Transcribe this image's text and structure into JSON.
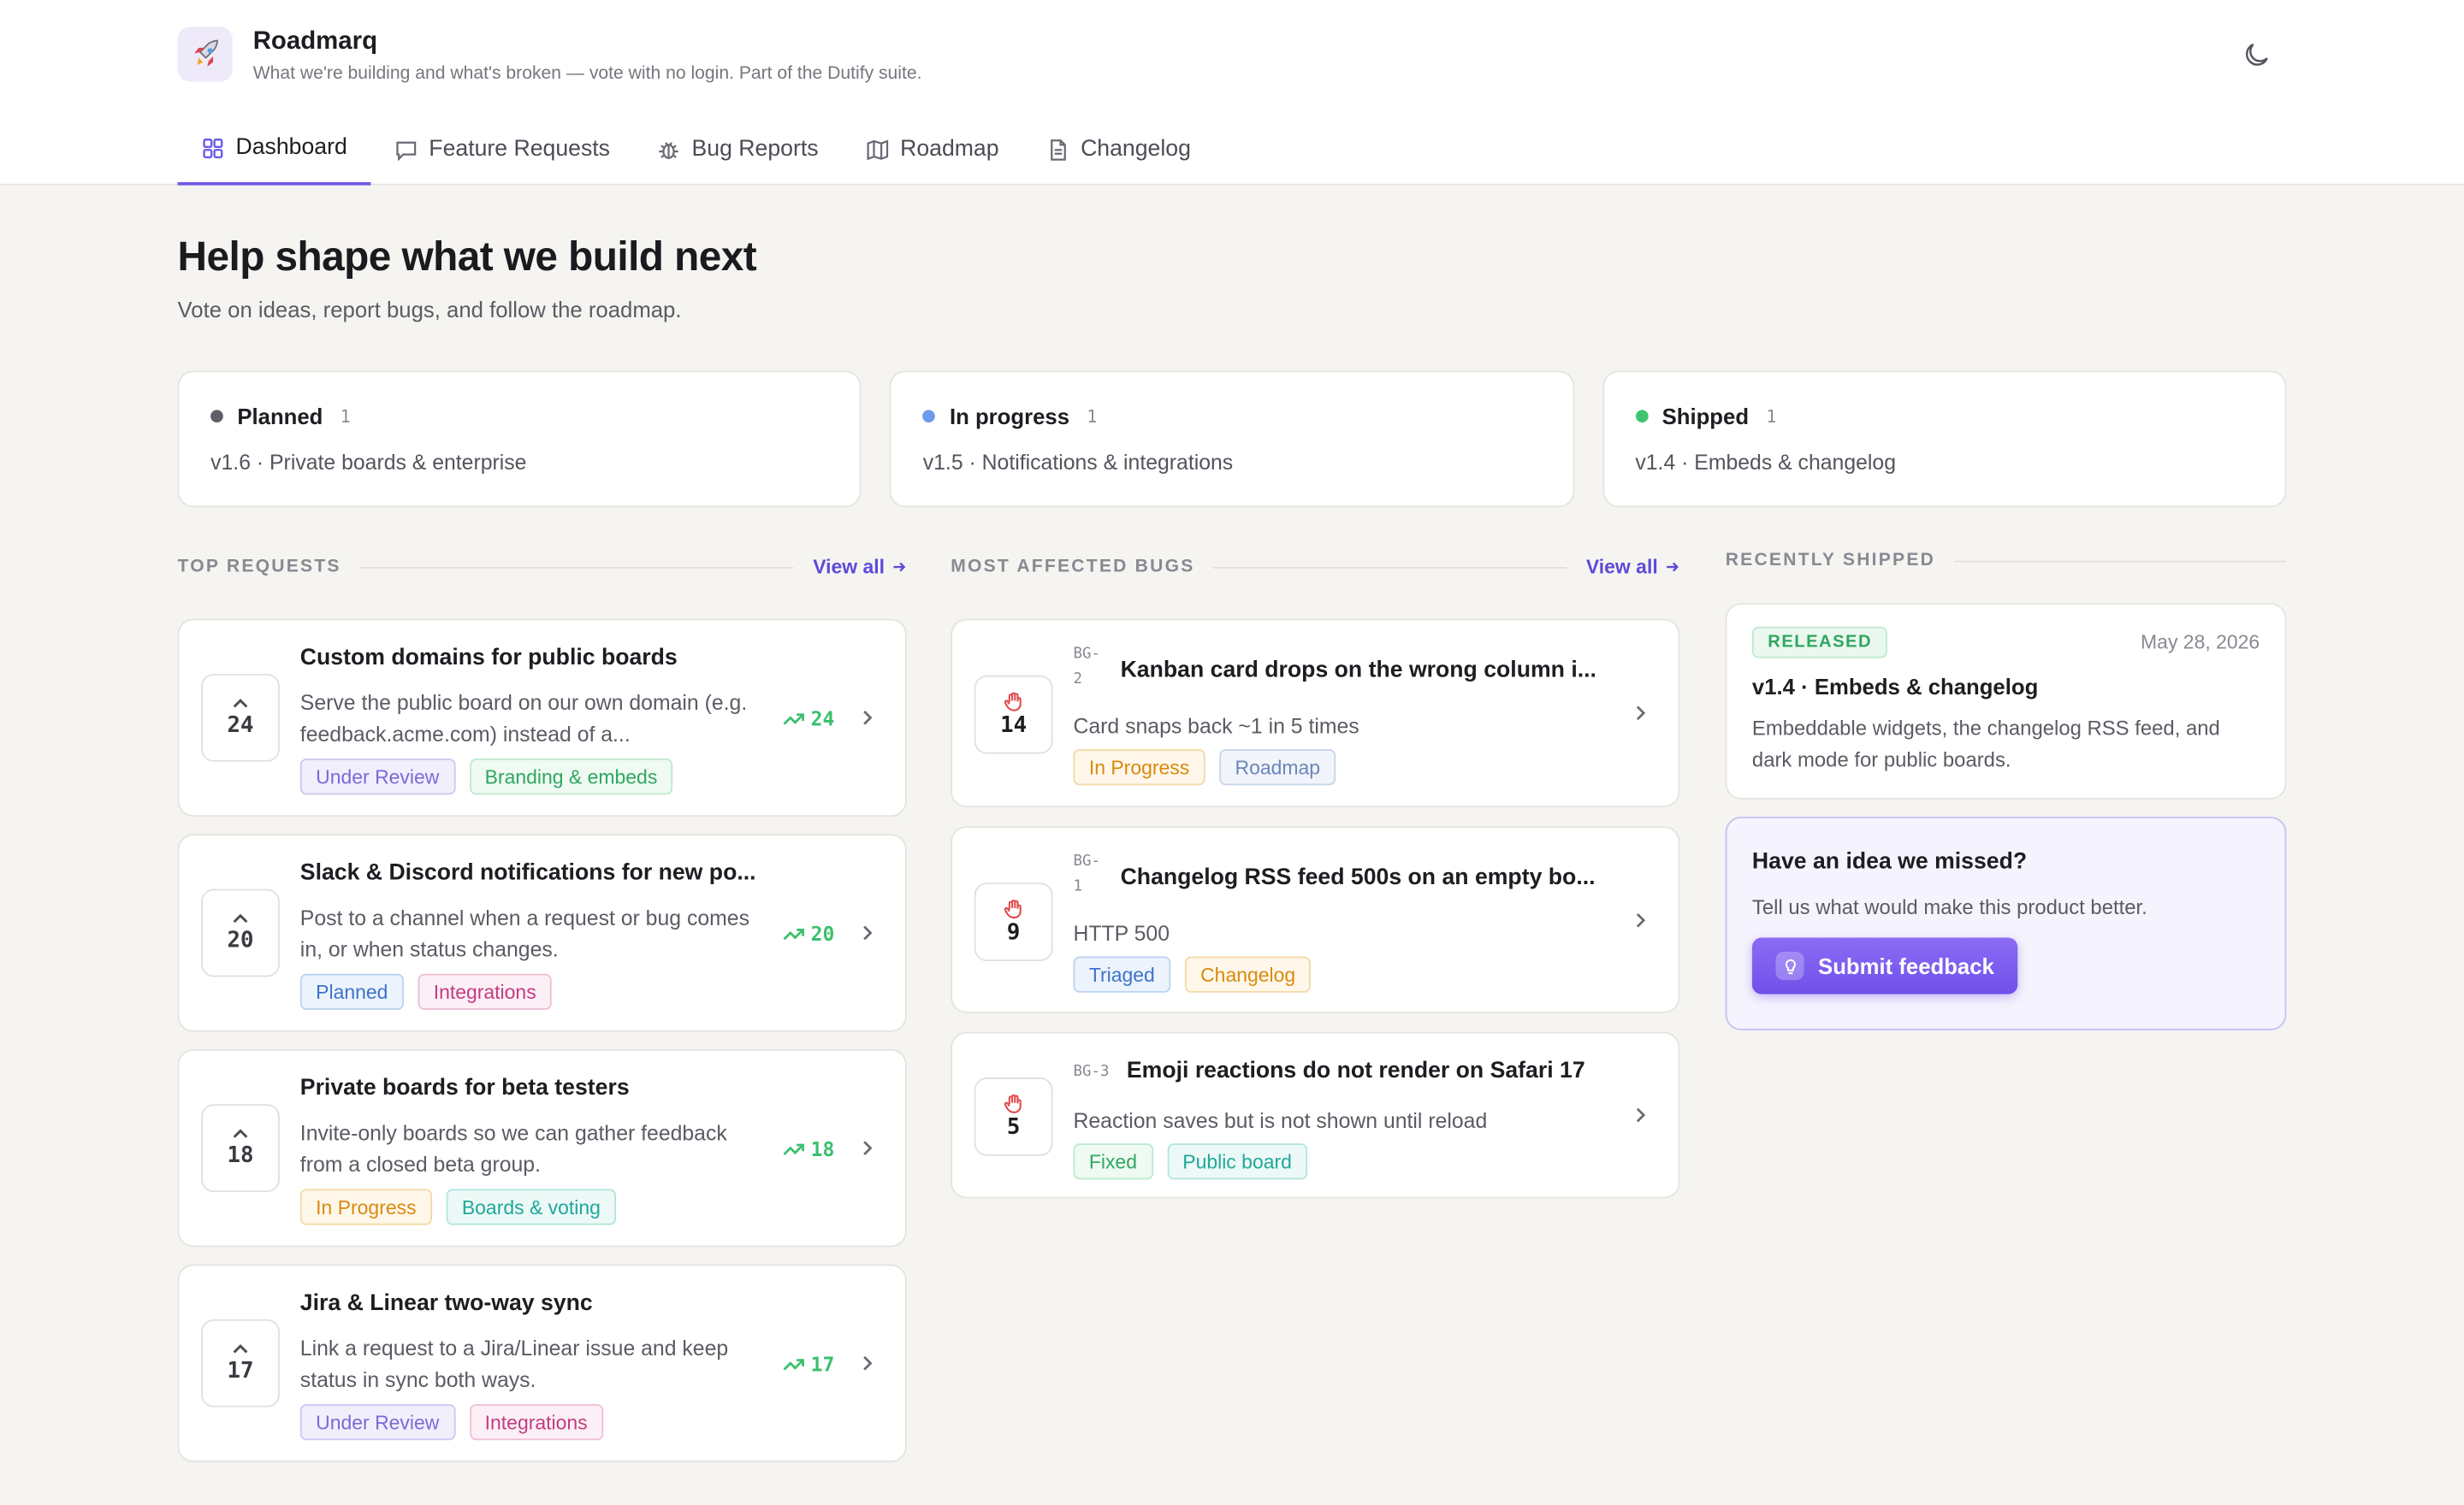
{
  "app": {
    "name": "Roadmarq",
    "tagline": "What we're building and what's broken — vote with no login. Part of the Dutify suite."
  },
  "tabs": [
    {
      "label": "Dashboard",
      "active": true
    },
    {
      "label": "Feature Requests"
    },
    {
      "label": "Bug Reports"
    },
    {
      "label": "Roadmap"
    },
    {
      "label": "Changelog"
    }
  ],
  "hero": {
    "title": "Help shape what we build next",
    "subtitle": "Vote on ideas, report bugs, and follow the roadmap."
  },
  "status_cards": [
    {
      "label": "Planned",
      "count": "1",
      "release": "v1.6 · Private boards & enterprise",
      "color": "#5f5e66"
    },
    {
      "label": "In progress",
      "count": "1",
      "release": "v1.5 · Notifications & integrations",
      "color": "#6b9bea"
    },
    {
      "label": "Shipped",
      "count": "1",
      "release": "v1.4 · Embeds & changelog",
      "color": "#3fc46f"
    }
  ],
  "requests": {
    "heading": "TOP REQUESTS",
    "view_all": "View all",
    "items": [
      {
        "votes": "24",
        "title": "Custom domains for public boards",
        "desc": "Serve the public board on our own domain (e.g. feedback.acme.com) instead of a...",
        "trend": "24",
        "tags": [
          "Under Review",
          "Branding & embeds"
        ]
      },
      {
        "votes": "20",
        "title": "Slack & Discord notifications for new po...",
        "desc": "Post to a channel when a request or bug comes in, or when status changes.",
        "trend": "20",
        "tags": [
          "Planned",
          "Integrations"
        ]
      },
      {
        "votes": "18",
        "title": "Private boards for beta testers",
        "desc": "Invite-only boards so we can gather feedback from a closed beta group.",
        "trend": "18",
        "tags": [
          "In Progress",
          "Boards & voting"
        ]
      },
      {
        "votes": "17",
        "title": "Jira & Linear two-way sync",
        "desc": "Link a request to a Jira/Linear issue and keep status in sync both ways.",
        "trend": "17",
        "tags": [
          "Under Review",
          "Integrations"
        ]
      }
    ]
  },
  "bugs": {
    "heading": "MOST AFFECTED BUGS",
    "view_all": "View all",
    "items": [
      {
        "id_a": "BG-",
        "id_b": "2",
        "count": "14",
        "title": "Kanban card drops on the wrong column i...",
        "desc": "Card snaps back ~1 in 5 times",
        "tags": [
          "In Progress",
          "Roadmap"
        ]
      },
      {
        "id_a": "BG-",
        "id_b": "1",
        "count": "9",
        "title": "Changelog RSS feed 500s on an empty bo...",
        "desc": "HTTP 500",
        "tags": [
          "Triaged",
          "Changelog"
        ]
      },
      {
        "id_a": "BG-3",
        "id_b": "",
        "count": "5",
        "title": "Emoji reactions do not render on Safari 17",
        "desc": "Reaction saves but is not shown until reload",
        "tags": [
          "Fixed",
          "Public board"
        ]
      }
    ]
  },
  "shipped": {
    "heading": "RECENTLY SHIPPED",
    "badge": "RELEASED",
    "date": "May 28, 2026",
    "title": "v1.4 · Embeds & changelog",
    "desc": "Embeddable widgets, the changelog RSS feed, and dark mode for public boards."
  },
  "idea": {
    "title": "Have an idea we missed?",
    "subtitle": "Tell us what would make this product better.",
    "button": "Submit feedback"
  },
  "tag_colors": {
    "Under Review": {
      "fg": "#7a6bd9",
      "bg": "#f1effc",
      "border": "#cfc8f3"
    },
    "Branding & embeds": {
      "fg": "#2fa760",
      "bg": "#eefaf2",
      "border": "#bfe9cf"
    },
    "Planned": {
      "fg": "#3d74c9",
      "bg": "#edf3fc",
      "border": "#bcd2f1"
    },
    "Integrations": {
      "fg": "#c23c82",
      "bg": "#fcf0f6",
      "border": "#efbfd7"
    },
    "In Progress": {
      "fg": "#d98a0f",
      "bg": "#fef7ea",
      "border": "#f4d9a8"
    },
    "Boards & voting": {
      "fg": "#1fa89a",
      "bg": "#edf9f7",
      "border": "#b3e5de"
    },
    "Roadmap": {
      "fg": "#6b86b8",
      "bg": "#f1f4fa",
      "border": "#c8d4ea"
    },
    "Triaged": {
      "fg": "#3d74c9",
      "bg": "#edf3fc",
      "border": "#bcd2f1"
    },
    "Changelog": {
      "fg": "#d98a0f",
      "bg": "#fef7ea",
      "border": "#f4d9a8"
    },
    "Fixed": {
      "fg": "#2fa760",
      "bg": "#eefaf2",
      "border": "#bfe9cf"
    },
    "Public board": {
      "fg": "#1fa89a",
      "bg": "#edf9f7",
      "border": "#b3e5de"
    }
  },
  "icons": {
    "logo": "rocket-icon",
    "theme": "moon-icon",
    "bug_vote": "hand-icon",
    "idea_button": "lightbulb-icon"
  }
}
